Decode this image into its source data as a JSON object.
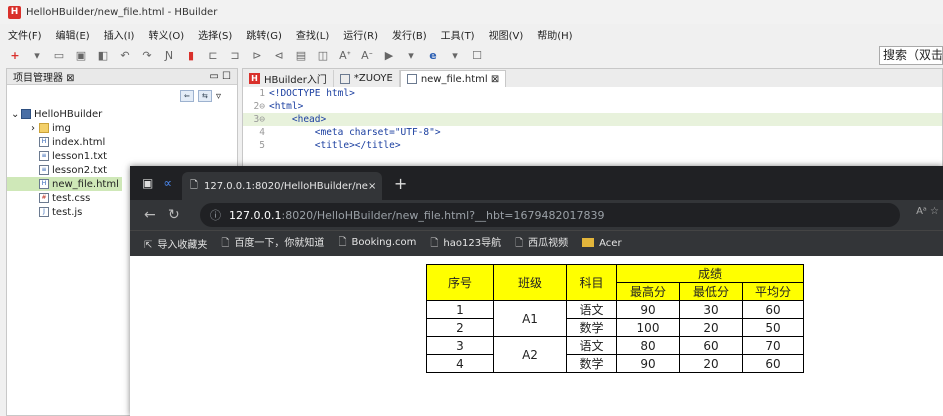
{
  "window_title": "HelloHBuilder/new_file.html - HBuilder",
  "app_logo": "H",
  "menu": [
    "文件(F)",
    "编辑(E)",
    "插入(I)",
    "转义(O)",
    "选择(S)",
    "跳转(G)",
    "查找(L)",
    "运行(R)",
    "发行(B)",
    "工具(T)",
    "视图(V)",
    "帮助(H)"
  ],
  "search_label": "搜索（双击",
  "project_panel": {
    "title": "项目管理器 ⊠",
    "tree": [
      {
        "label": "HelloHBuilder",
        "icon": "project-icon",
        "expander": "⌄"
      },
      {
        "label": "img",
        "icon": "folder-icon",
        "expander": "›"
      },
      {
        "label": "index.html",
        "icon": "html-file-icon"
      },
      {
        "label": "lesson1.txt",
        "icon": "text-file-icon"
      },
      {
        "label": "lesson2.txt",
        "icon": "text-file-icon"
      },
      {
        "label": "new_file.html",
        "icon": "html-file-icon",
        "selected": true
      },
      {
        "label": "test.css",
        "icon": "css-file-icon"
      },
      {
        "label": "test.js",
        "icon": "js-file-icon"
      }
    ]
  },
  "editor": {
    "tabs": [
      {
        "label": "HBuilder入门"
      },
      {
        "label": "*ZUOYE"
      },
      {
        "label": "new_file.html ⊠",
        "active": true
      }
    ],
    "lines": [
      {
        "num": "1",
        "text": "<!DOCTYPE html>"
      },
      {
        "num": "2⊖",
        "text": "<html>"
      },
      {
        "num": "3⊖",
        "text": "    <head>"
      },
      {
        "num": "4",
        "text": "        <meta charset=\"UTF-8\">"
      },
      {
        "num": "5",
        "text": "        <title></title>"
      }
    ]
  },
  "browser": {
    "tab_title": "127.0.0.1:8020/HelloHBuilder/ne",
    "tab_close": "×",
    "new_tab": "+",
    "url_host": "127.0.0.1",
    "url_rest": ":8020/HelloHBuilder/new_file.html?__hbt=1679482017839",
    "bookmarks": [
      "导入收藏夹",
      "百度一下，你就知道",
      "Booking.com",
      "hao123导航",
      "西瓜视频",
      "Acer"
    ],
    "right_text": "Aᵃ ☆"
  },
  "table": {
    "header_top": [
      "序号",
      "班级",
      "科目",
      "成绩"
    ],
    "header_sub": [
      "最高分",
      "最低分",
      "平均分"
    ],
    "rows": [
      {
        "no": "1",
        "class": "A1",
        "subject": "语文",
        "max": "90",
        "min": "30",
        "avg": "60"
      },
      {
        "no": "2",
        "class": "",
        "subject": "数学",
        "max": "100",
        "min": "20",
        "avg": "50"
      },
      {
        "no": "3",
        "class": "A2",
        "subject": "语文",
        "max": "80",
        "min": "60",
        "avg": "70"
      },
      {
        "no": "4",
        "class": "",
        "subject": "数学",
        "max": "90",
        "min": "20",
        "avg": "60"
      }
    ]
  },
  "colors": {
    "header_bg": "#ffff00",
    "selected_item": "#cfe8b8",
    "hbuilder_red": "#d9302b"
  }
}
